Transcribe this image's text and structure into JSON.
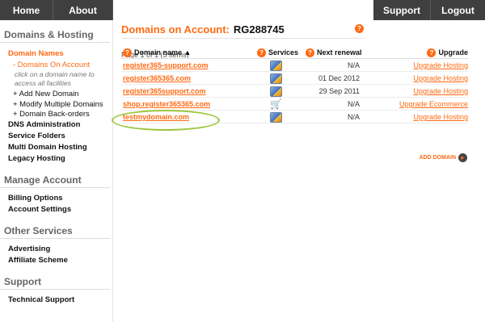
{
  "topnav": {
    "home": "Home",
    "about": "About",
    "support": "Support",
    "logout": "Logout"
  },
  "sidebar": {
    "domains_hosting": {
      "heading": "Domains & Hosting",
      "domain_names": "Domain Names",
      "domains_on_account": "- Domains On Account",
      "note": "click on a domain name to access all facilities",
      "add_new": "+ Add New Domain",
      "modify": "+ Modify Multiple Domains",
      "backorders": "+ Domain Back-orders",
      "dns": "DNS Administration",
      "service_folders": "Service Folders",
      "multi_hosting": "Multi Domain Hosting",
      "legacy": "Legacy Hosting"
    },
    "manage_account": {
      "heading": "Manage Account",
      "billing": "Billing Options",
      "settings": "Account Settings"
    },
    "other_services": {
      "heading": "Other Services",
      "advertising": "Advertising",
      "affiliate": "Affiliate Scheme"
    },
    "support": {
      "heading": "Support",
      "technical": "Technical Support"
    }
  },
  "main": {
    "title": "Domains on Account:",
    "account_id": "RG288745",
    "pager": "Page 1 of 1 (5 items)",
    "help_glyph": "?",
    "columns": {
      "domain": "Domain name ▲",
      "services": "Services",
      "renewal": "Next renewal",
      "upgrade": "Upgrade"
    },
    "rows": [
      {
        "domain": "register365-support.com",
        "service_icon": "hosting-icon",
        "renewal": "N/A",
        "upgrade": "Upgrade Hosting"
      },
      {
        "domain": "register365365.com",
        "service_icon": "hosting-icon",
        "renewal": "01 Dec 2012",
        "upgrade": "Upgrade Hosting"
      },
      {
        "domain": "register365support.com",
        "service_icon": "hosting-icon",
        "renewal": "29 Sep 2011",
        "upgrade": "Upgrade Hosting"
      },
      {
        "domain": "shop.register365365.com",
        "service_icon": "cart-icon",
        "renewal": "N/A",
        "upgrade": "Upgrade Ecommerce"
      },
      {
        "domain": "testmydomain.com",
        "service_icon": "hosting-icon",
        "renewal": "N/A",
        "upgrade": "Upgrade Hosting"
      }
    ],
    "add_domain": "ADD DOMAIN"
  },
  "colors": {
    "accent": "#ff6a13",
    "nav_bg": "#3f3f3f",
    "highlight_ring": "#9cc63c"
  }
}
